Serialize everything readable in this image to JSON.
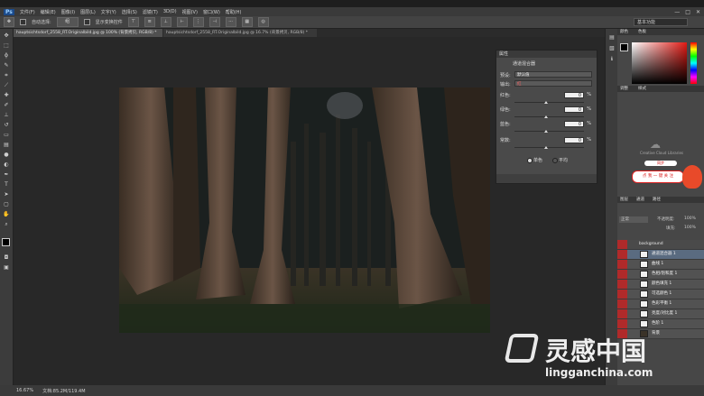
{
  "app": {
    "logo": "Ps",
    "menu": [
      "文件(F)",
      "编辑(E)",
      "图像(I)",
      "图层(L)",
      "文字(Y)",
      "选择(S)",
      "滤镜(T)",
      "3D(D)",
      "视图(V)",
      "窗口(W)",
      "帮助(H)"
    ],
    "win_controls": [
      "—",
      "□",
      "✕"
    ]
  },
  "options": {
    "auto_select_label": "自动选择:",
    "auto_select_value": "组",
    "show_transform": "显示变换控件",
    "workspace": "基本功能"
  },
  "tabs": [
    {
      "label": "hauptsichtsdorf_2558_RT.Originalbild.jpg @ 100% (背景拷贝, RGB/8) *"
    },
    {
      "label": "hauptsichtsdorf_2558_RT.Originalbild.jpg @ 16.7% (背景拷贝, RGB/8) *"
    }
  ],
  "status": {
    "zoom": "16.67%",
    "doc": "文档:85.2M/119.4M"
  },
  "properties": {
    "title": "属性",
    "subtitle": "通道混合器",
    "preset_label": "预设:",
    "preset_value": "默认值",
    "output_label": "输出:",
    "output_value": "红",
    "rows": [
      {
        "label": "红色:",
        "value": "0",
        "pct": "%"
      },
      {
        "label": "绿色:",
        "value": "0",
        "pct": "%"
      },
      {
        "label": "蓝色:",
        "value": "0",
        "pct": "%"
      },
      {
        "label": "常数:",
        "value": "0",
        "pct": "%"
      }
    ],
    "radio1": "单色",
    "radio2": "平均"
  },
  "color_panel": {
    "tab1": "颜色",
    "tab2": "色板"
  },
  "adjust_panel": {
    "tab1": "调整",
    "tab2": "样式"
  },
  "cloud": {
    "text": "Creative Cloud Libraries",
    "btn": "同步",
    "promo": "关注我们!",
    "promo_btn": "点 我 一 键 关 注"
  },
  "layers_panel": {
    "tabs": [
      "图层",
      "通道",
      "路径"
    ],
    "blend": "正常",
    "opacity_label": "不透明度:",
    "opacity": "100%",
    "fill_label": "填充:",
    "fill": "100%",
    "group": "background",
    "layers": [
      {
        "name": "通道混合器 1",
        "active": true
      },
      {
        "name": "曲线 1",
        "active": false
      },
      {
        "name": "色相/饱和度 1",
        "active": false
      },
      {
        "name": "颜色填充 1",
        "active": false
      },
      {
        "name": "可选颜色 1",
        "active": false
      },
      {
        "name": "色彩平衡 1",
        "active": false
      },
      {
        "name": "亮度/对比度 1",
        "active": false
      },
      {
        "name": "色阶 1",
        "active": false
      }
    ],
    "bottom_layer": "背景"
  },
  "watermark": {
    "text": "灵感中国",
    "url": "lingganchina.com"
  },
  "colors": {
    "accent": "#b02a2a",
    "active_layer": "#5a6b80",
    "field_hue": "#e21a14"
  }
}
